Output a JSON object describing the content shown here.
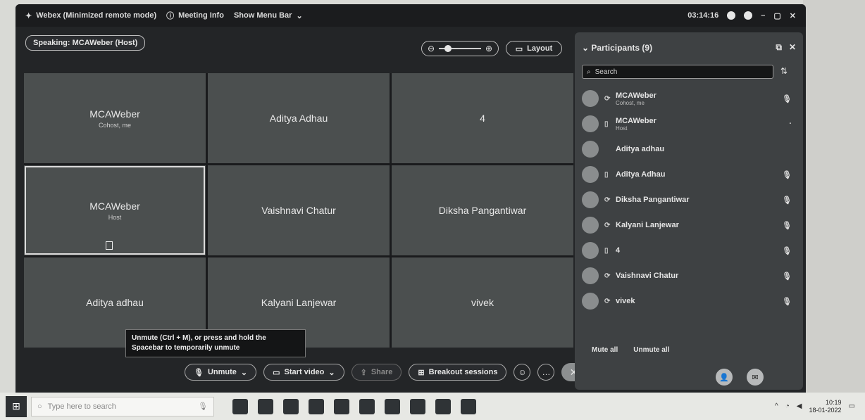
{
  "title_bar": {
    "app_title": "Webex (Minimized remote mode)",
    "meeting_info": "Meeting Info",
    "menu_toggle": "Show Menu Bar",
    "time": "03:14:16"
  },
  "speaking_badge": "Speaking: MCAWeber (Host)",
  "controls": {
    "layout_label": "Layout"
  },
  "tiles": [
    {
      "name": "MCAWeber",
      "sub": "Cohost, me",
      "active": false
    },
    {
      "name": "Aditya Adhau",
      "sub": "",
      "active": false
    },
    {
      "name": "4",
      "sub": "",
      "active": false
    },
    {
      "name": "MCAWeber",
      "sub": "Host",
      "active": true
    },
    {
      "name": "Vaishnavi Chatur",
      "sub": "",
      "active": false
    },
    {
      "name": "Diksha Pangantiwar",
      "sub": "",
      "active": false
    },
    {
      "name": "Aditya adhau",
      "sub": "",
      "active": false
    },
    {
      "name": "Kalyani Lanjewar",
      "sub": "",
      "active": false
    },
    {
      "name": "vivek",
      "sub": "",
      "active": false
    }
  ],
  "tooltip": "Unmute (Ctrl + M), or press and hold the Spacebar to temporarily unmute",
  "toolbar": {
    "unmute": "Unmute",
    "start_video": "Start video",
    "share": "Share",
    "breakout": "Breakout sessions"
  },
  "participants_panel": {
    "title": "Participants (9)",
    "search_placeholder": "Search",
    "participants": [
      {
        "name": "MCAWeber",
        "role": "Cohost, me"
      },
      {
        "name": "MCAWeber",
        "role": "Host"
      },
      {
        "name": "Aditya adhau",
        "role": ""
      },
      {
        "name": "Aditya Adhau",
        "role": ""
      },
      {
        "name": "Diksha Pangantiwar",
        "role": ""
      },
      {
        "name": "Kalyani Lanjewar",
        "role": ""
      },
      {
        "name": "4",
        "role": ""
      },
      {
        "name": "Vaishnavi Chatur",
        "role": ""
      },
      {
        "name": "vivek",
        "role": ""
      }
    ],
    "mute_all": "Mute all",
    "unmute_all": "Unmute all"
  },
  "taskbar": {
    "search_placeholder": "Type here to search",
    "time": "10:19",
    "date": "18-01-2022"
  }
}
